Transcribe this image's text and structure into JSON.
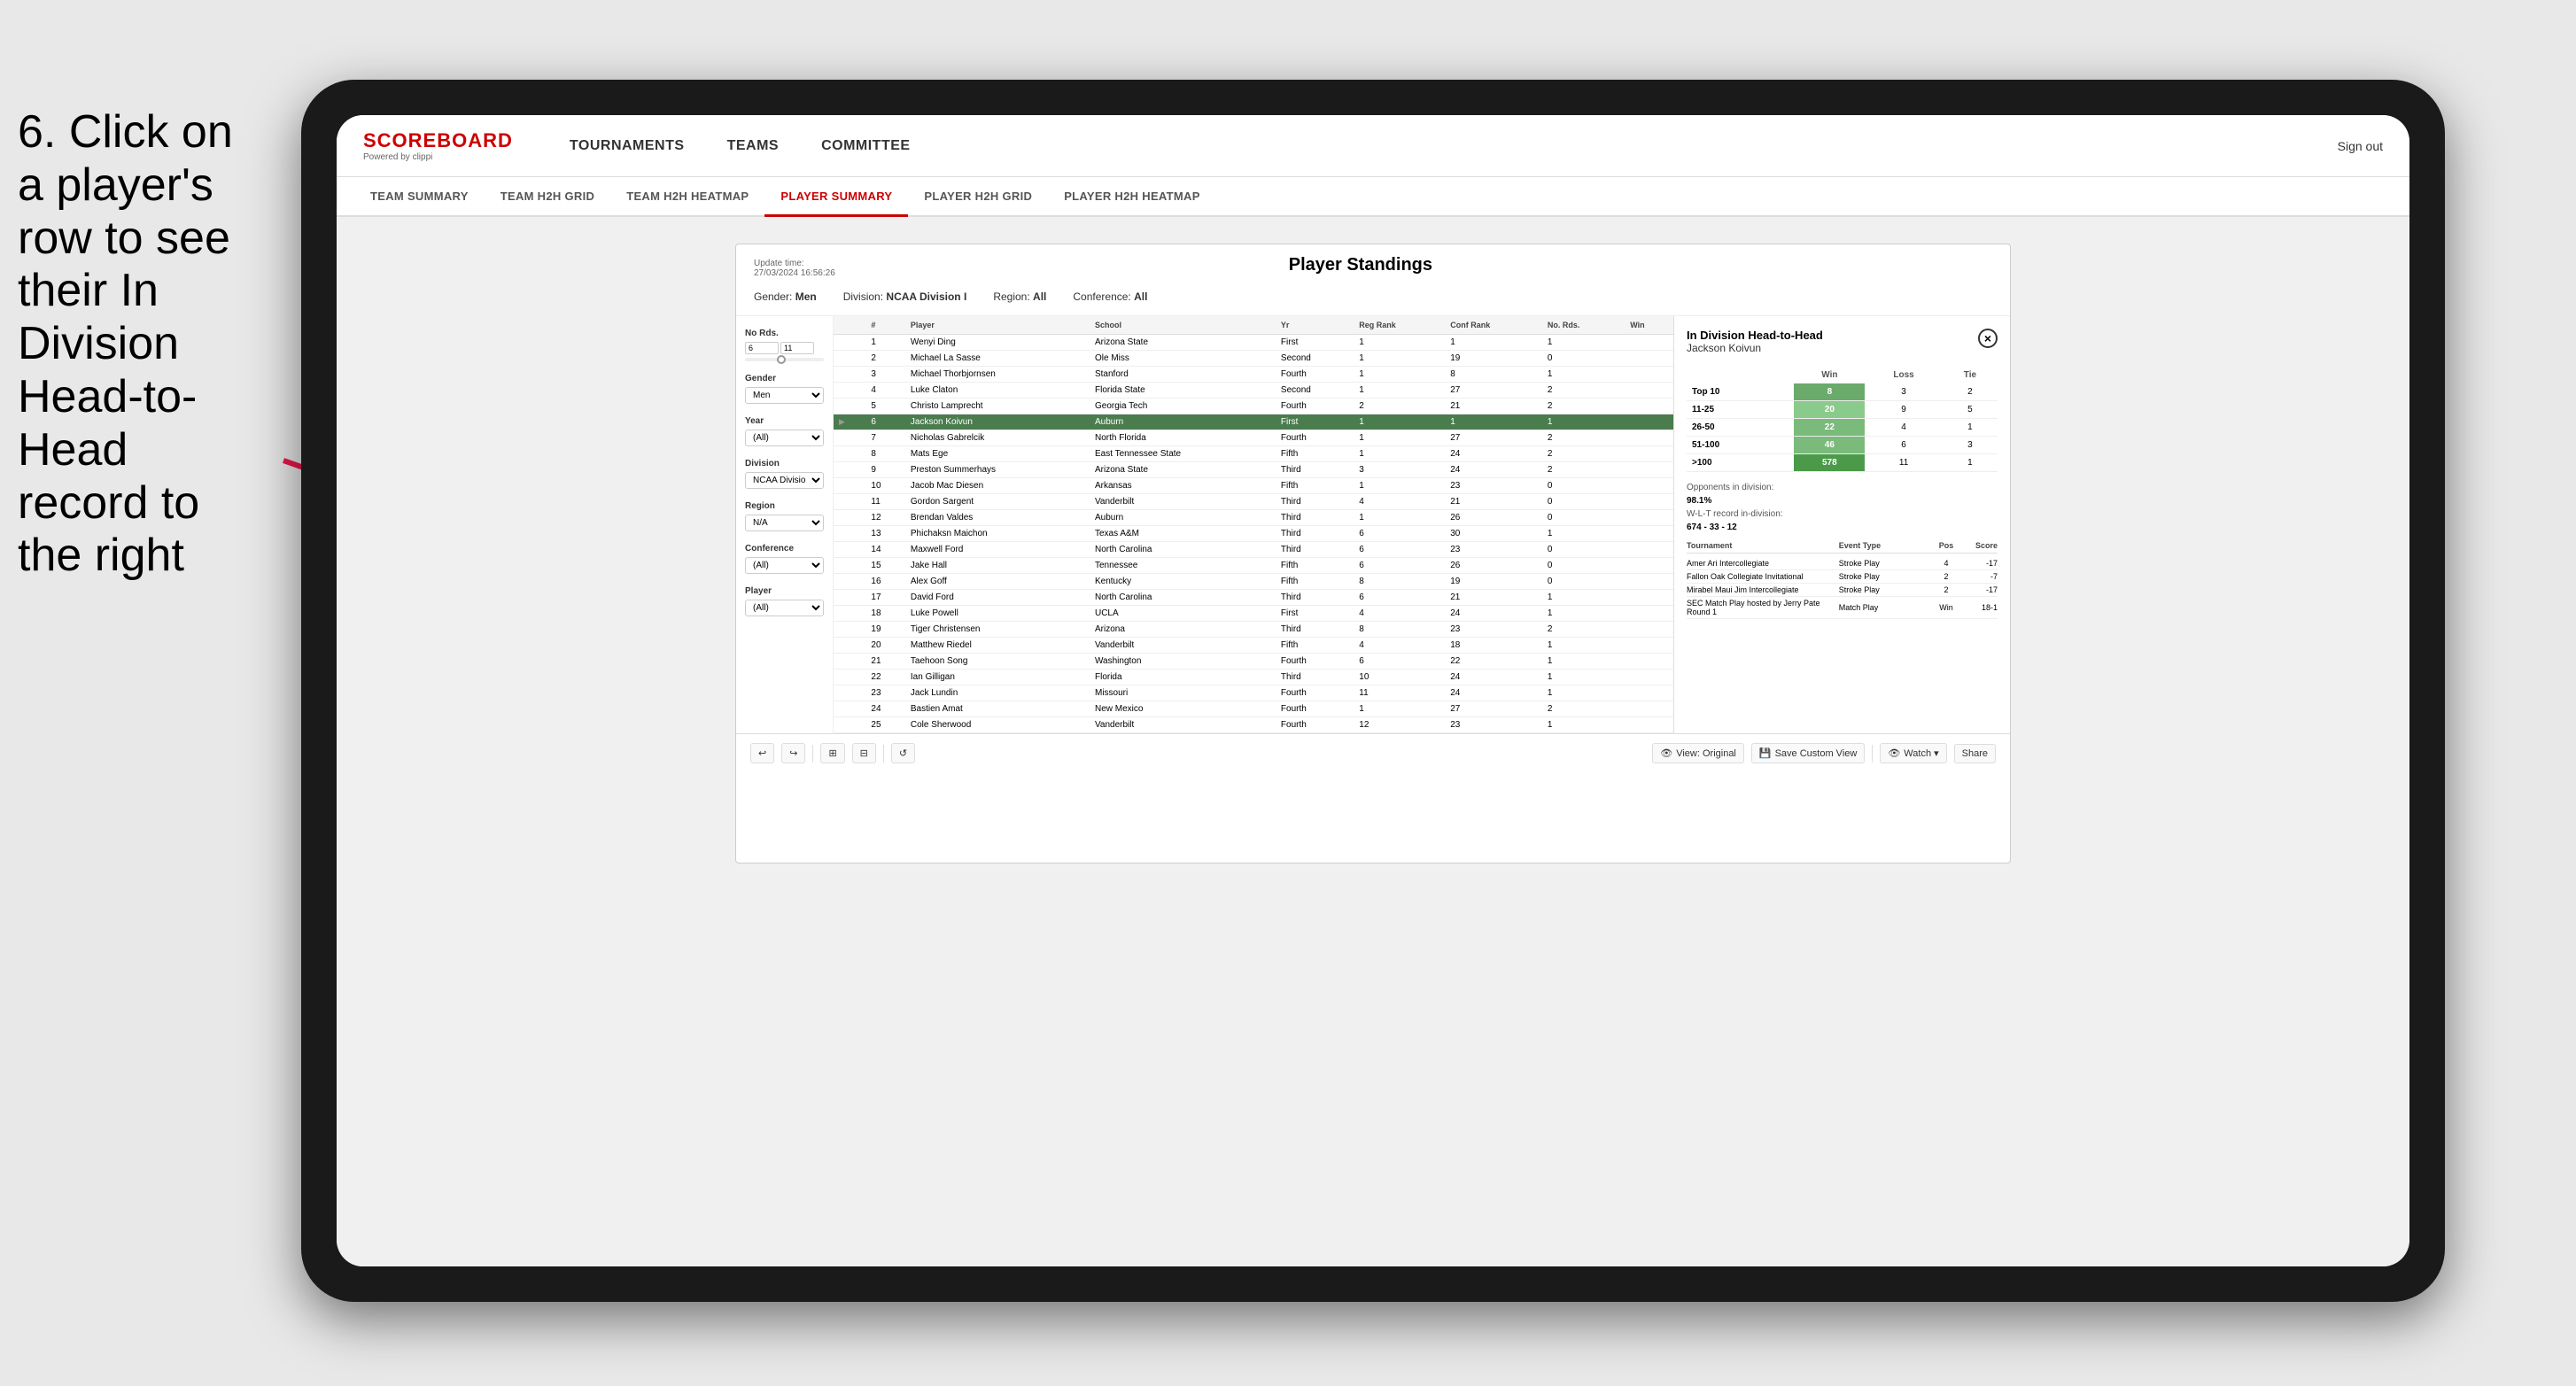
{
  "instruction": {
    "text": "6. Click on a player's row to see their In Division Head-to-Head record to the right"
  },
  "app": {
    "logo": {
      "title": "SCOREBOARD",
      "sub": "Powered by clippi"
    },
    "nav": {
      "items": [
        "TOURNAMENTS",
        "TEAMS",
        "COMMITTEE"
      ],
      "signout": "Sign out"
    },
    "subnav": {
      "items": [
        "TEAM SUMMARY",
        "TEAM H2H GRID",
        "TEAM H2H HEATMAP",
        "PLAYER SUMMARY",
        "PLAYER H2H GRID",
        "PLAYER H2H HEATMAP"
      ],
      "active": "PLAYER SUMMARY"
    }
  },
  "panel": {
    "update_label": "Update time:",
    "update_time": "27/03/2024 16:56:26",
    "title": "Player Standings",
    "filters": {
      "gender_label": "Gender:",
      "gender": "Men",
      "division_label": "Division:",
      "division": "NCAA Division I",
      "region_label": "Region:",
      "region": "All",
      "conference_label": "Conference:",
      "conference": "All"
    },
    "sidebar": {
      "no_rds_label": "No Rds.",
      "gender_label": "Gender",
      "gender_value": "Men",
      "year_label": "Year",
      "year_value": "(All)",
      "division_label": "Division",
      "division_value": "NCAA Division I",
      "region_label": "Region",
      "region_value": "N/A",
      "conference_label": "Conference",
      "conference_value": "(All)",
      "player_label": "Player",
      "player_value": "(All)"
    },
    "table": {
      "headers": [
        "",
        "#",
        "Player",
        "School",
        "Yr",
        "Reg Rank",
        "Conf Rank",
        "No. Rds.",
        "Win"
      ],
      "rows": [
        {
          "rank": "",
          "num": "1",
          "player": "Wenyi Ding",
          "school": "Arizona State",
          "yr": "First",
          "reg": "1",
          "conf": "1",
          "rds": "1",
          "win": ""
        },
        {
          "rank": "",
          "num": "2",
          "player": "Michael La Sasse",
          "school": "Ole Miss",
          "yr": "Second",
          "reg": "1",
          "conf": "19",
          "rds": "0",
          "win": ""
        },
        {
          "rank": "",
          "num": "3",
          "player": "Michael Thorbjornsen",
          "school": "Stanford",
          "yr": "Fourth",
          "reg": "1",
          "conf": "8",
          "rds": "1",
          "win": ""
        },
        {
          "rank": "",
          "num": "4",
          "player": "Luke Claton",
          "school": "Florida State",
          "yr": "Second",
          "reg": "1",
          "conf": "27",
          "rds": "2",
          "win": ""
        },
        {
          "rank": "",
          "num": "5",
          "player": "Christo Lamprecht",
          "school": "Georgia Tech",
          "yr": "Fourth",
          "reg": "2",
          "conf": "21",
          "rds": "2",
          "win": ""
        },
        {
          "rank": "selected",
          "num": "6",
          "player": "Jackson Koivun",
          "school": "Auburn",
          "yr": "First",
          "reg": "1",
          "conf": "1",
          "rds": "1",
          "win": ""
        },
        {
          "rank": "",
          "num": "7",
          "player": "Nicholas Gabrelcik",
          "school": "North Florida",
          "yr": "Fourth",
          "reg": "1",
          "conf": "27",
          "rds": "2",
          "win": ""
        },
        {
          "rank": "",
          "num": "8",
          "player": "Mats Ege",
          "school": "East Tennessee State",
          "yr": "Fifth",
          "reg": "1",
          "conf": "24",
          "rds": "2",
          "win": ""
        },
        {
          "rank": "",
          "num": "9",
          "player": "Preston Summerhays",
          "school": "Arizona State",
          "yr": "Third",
          "reg": "3",
          "conf": "24",
          "rds": "2",
          "win": ""
        },
        {
          "rank": "",
          "num": "10",
          "player": "Jacob Mac Diesen",
          "school": "Arkansas",
          "yr": "Fifth",
          "reg": "1",
          "conf": "23",
          "rds": "0",
          "win": ""
        },
        {
          "rank": "",
          "num": "11",
          "player": "Gordon Sargent",
          "school": "Vanderbilt",
          "yr": "Third",
          "reg": "4",
          "conf": "21",
          "rds": "0",
          "win": ""
        },
        {
          "rank": "",
          "num": "12",
          "player": "Brendan Valdes",
          "school": "Auburn",
          "yr": "Third",
          "reg": "1",
          "conf": "26",
          "rds": "0",
          "win": ""
        },
        {
          "rank": "",
          "num": "13",
          "player": "Phichaksn Maichon",
          "school": "Texas A&M",
          "yr": "Third",
          "reg": "6",
          "conf": "30",
          "rds": "1",
          "win": ""
        },
        {
          "rank": "",
          "num": "14",
          "player": "Maxwell Ford",
          "school": "North Carolina",
          "yr": "Third",
          "reg": "6",
          "conf": "23",
          "rds": "0",
          "win": ""
        },
        {
          "rank": "",
          "num": "15",
          "player": "Jake Hall",
          "school": "Tennessee",
          "yr": "Fifth",
          "reg": "6",
          "conf": "26",
          "rds": "0",
          "win": ""
        },
        {
          "rank": "",
          "num": "16",
          "player": "Alex Goff",
          "school": "Kentucky",
          "yr": "Fifth",
          "reg": "8",
          "conf": "19",
          "rds": "0",
          "win": ""
        },
        {
          "rank": "",
          "num": "17",
          "player": "David Ford",
          "school": "North Carolina",
          "yr": "Third",
          "reg": "6",
          "conf": "21",
          "rds": "1",
          "win": ""
        },
        {
          "rank": "",
          "num": "18",
          "player": "Luke Powell",
          "school": "UCLA",
          "yr": "First",
          "reg": "4",
          "conf": "24",
          "rds": "1",
          "win": ""
        },
        {
          "rank": "",
          "num": "19",
          "player": "Tiger Christensen",
          "school": "Arizona",
          "yr": "Third",
          "reg": "8",
          "conf": "23",
          "rds": "2",
          "win": ""
        },
        {
          "rank": "",
          "num": "20",
          "player": "Matthew Riedel",
          "school": "Vanderbilt",
          "yr": "Fifth",
          "reg": "4",
          "conf": "18",
          "rds": "1",
          "win": ""
        },
        {
          "rank": "",
          "num": "21",
          "player": "Taehoon Song",
          "school": "Washington",
          "yr": "Fourth",
          "reg": "6",
          "conf": "22",
          "rds": "1",
          "win": ""
        },
        {
          "rank": "",
          "num": "22",
          "player": "Ian Gilligan",
          "school": "Florida",
          "yr": "Third",
          "reg": "10",
          "conf": "24",
          "rds": "1",
          "win": ""
        },
        {
          "rank": "",
          "num": "23",
          "player": "Jack Lundin",
          "school": "Missouri",
          "yr": "Fourth",
          "reg": "11",
          "conf": "24",
          "rds": "1",
          "win": ""
        },
        {
          "rank": "",
          "num": "24",
          "player": "Bastien Amat",
          "school": "New Mexico",
          "yr": "Fourth",
          "reg": "1",
          "conf": "27",
          "rds": "2",
          "win": ""
        },
        {
          "rank": "",
          "num": "25",
          "player": "Cole Sherwood",
          "school": "Vanderbilt",
          "yr": "Fourth",
          "reg": "12",
          "conf": "23",
          "rds": "1",
          "win": ""
        }
      ]
    },
    "h2h": {
      "title": "In Division Head-to-Head",
      "player": "Jackson Koivun",
      "close_btn": "×",
      "table": {
        "headers": [
          "",
          "Win",
          "Loss",
          "Tie"
        ],
        "rows": [
          {
            "label": "Top 10",
            "win": "8",
            "loss": "3",
            "tie": "2"
          },
          {
            "label": "11-25",
            "win": "20",
            "loss": "9",
            "tie": "5"
          },
          {
            "label": "26-50",
            "win": "22",
            "loss": "4",
            "tie": "1"
          },
          {
            "label": "51-100",
            "win": "46",
            "loss": "6",
            "tie": "3"
          },
          {
            "label": ">100",
            "win": "578",
            "loss": "11",
            "tie": "1"
          }
        ]
      },
      "opponents_label": "Opponents in division:",
      "opponents_value": "98.1%",
      "record_label": "W-L-T record in-division:",
      "record_value": "674 - 33 - 12",
      "tournaments": {
        "headers": [
          "Tournament",
          "Event Type",
          "Pos",
          "Score"
        ],
        "rows": [
          {
            "tournament": "Amer Ari Intercollegiate",
            "type": "Stroke Play",
            "pos": "4",
            "score": "-17"
          },
          {
            "tournament": "Fallon Oak Collegiate Invitational",
            "type": "Stroke Play",
            "pos": "2",
            "score": "-7"
          },
          {
            "tournament": "Mirabel Maui Jim Intercollegiate",
            "type": "Stroke Play",
            "pos": "2",
            "score": "-17"
          },
          {
            "tournament": "SEC Match Play hosted by Jerry Pate Round 1",
            "type": "Match Play",
            "pos": "Win",
            "score": "18-1"
          }
        ]
      }
    }
  },
  "toolbar": {
    "undo": "↩",
    "redo": "↪",
    "view_original": "View: Original",
    "save_custom": "Save Custom View",
    "watch": "Watch ▾",
    "share": "Share"
  }
}
